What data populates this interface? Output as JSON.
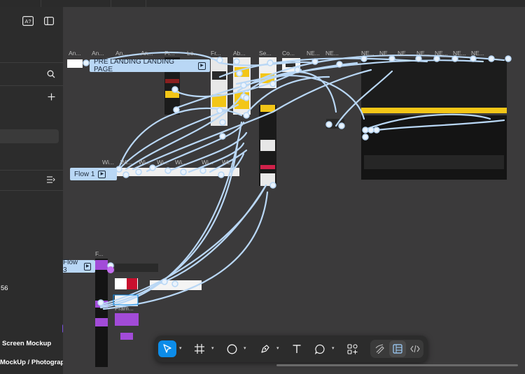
{
  "sidebar": {
    "number_fragment": "56",
    "layer_items": [
      "Screen Mockup",
      "MockUp / Photograph"
    ],
    "icons": [
      "ask-ai-icon",
      "panel-toggle-icon",
      "search-icon",
      "add-icon",
      "filter-list-icon",
      "component-icon"
    ]
  },
  "canvas": {
    "flows": [
      {
        "label": "PRE LANDING  LANDING PAGE"
      },
      {
        "label": "Flow 1"
      },
      {
        "label": "Flow 3"
      }
    ],
    "frame_labels": [
      "An...",
      "An...",
      "An...",
      "An...",
      "Fr...",
      "Lo...",
      "Fr...",
      "Ab...",
      "Se...",
      "Co...",
      "NE...",
      "NE...",
      "NE...",
      "NE...",
      "NE...",
      "NE...",
      "NE...",
      "NE...",
      "NE...",
      "Wi...",
      "Wi...",
      "Wi...",
      "Wi...",
      "Wi...",
      "Wi...",
      "Wi...",
      "F...",
      "Fram..."
    ],
    "colors": {
      "connector": "#b9d7f5",
      "accent_yellow": "#f3c617",
      "accent_purple": "#a24bd8",
      "selection_blue": "#0c8ce9"
    }
  },
  "toolbar": {
    "tools": [
      "move-tool",
      "frame-tool",
      "shape-tool",
      "pen-tool",
      "text-tool",
      "comment-tool",
      "actions-tool"
    ],
    "modes": [
      "draw-mode",
      "design-mode",
      "dev-mode"
    ],
    "active_tool": "move-tool",
    "active_mode": "design-mode"
  }
}
